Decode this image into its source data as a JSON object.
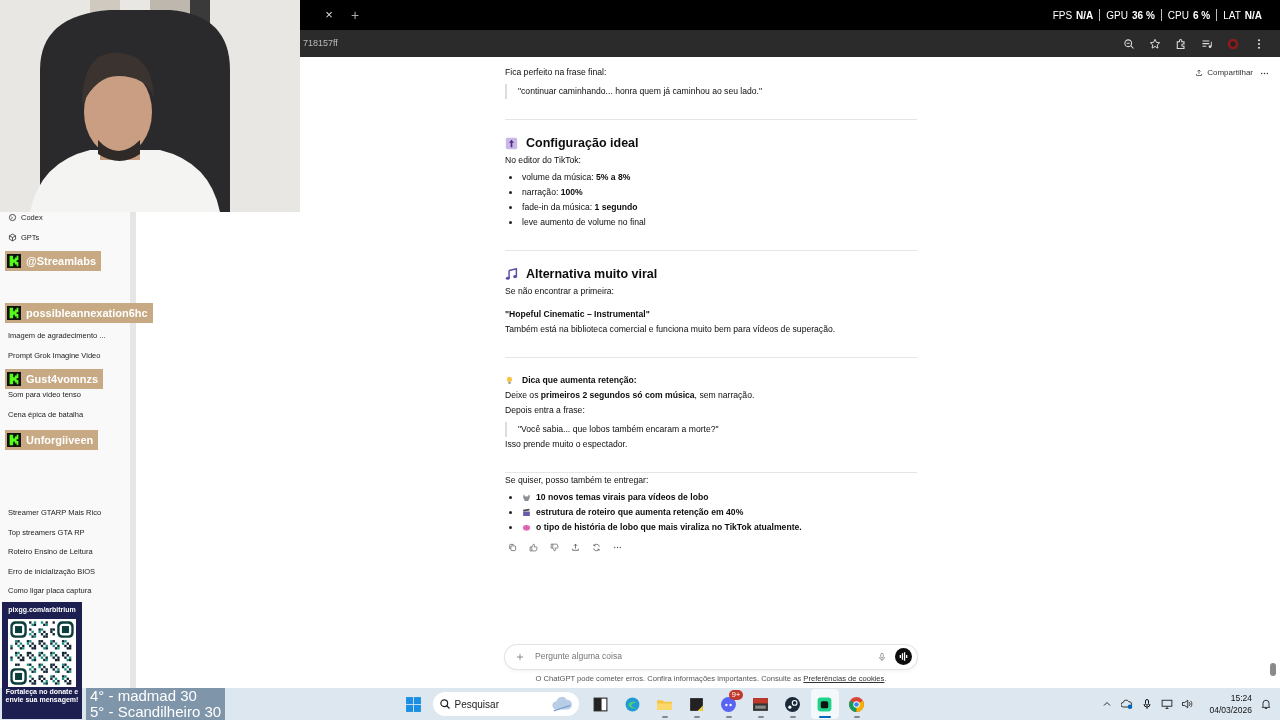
{
  "webcam": {
    "kind": "picture"
  },
  "browser": {
    "tab_close": "×",
    "new_tab": "+",
    "url": "718157ff"
  },
  "perf_overlay": [
    {
      "label": "FPS",
      "value": "N/A"
    },
    {
      "label": "GPU",
      "value": "36 %"
    },
    {
      "label": "CPU",
      "value": "6 %"
    },
    {
      "label": "LAT",
      "value": "N/A"
    }
  ],
  "sidebar": {
    "sections": [
      {
        "items": [
          {
            "label": "Codex"
          },
          {
            "label": "GPTs"
          }
        ]
      },
      {
        "items": [
          {
            "label": "Imagem de agradecimento ..."
          },
          {
            "label": "Prompt Grok Imagine Video"
          }
        ]
      },
      {
        "items": [
          {
            "label": "Som para video tenso"
          },
          {
            "label": "Cena épica de batalha"
          }
        ]
      },
      {
        "items": [
          {
            "label": "Streamer GTARP Mais Rico"
          },
          {
            "label": "Top streamers GTA RP"
          },
          {
            "label": "Roteiro Ensino de Leitura"
          },
          {
            "label": "Erro de inicialização BIOS"
          },
          {
            "label": "Como ligar placa captura"
          }
        ]
      }
    ]
  },
  "chat_overlay": [
    {
      "user": "@Streamlabs"
    },
    {
      "user": "possibleannexation6hc"
    },
    {
      "user": "Gust4vomnzs"
    },
    {
      "user": "Unforgiiveen"
    }
  ],
  "header": {
    "share": "Compartilhar"
  },
  "message": {
    "blocks": [
      {
        "kind": "paragraph",
        "text": "Fica perfeito na frase final:"
      },
      {
        "kind": "quote",
        "text": "\"continuar caminhando... honra quem já caminhou ao seu lado.\""
      },
      {
        "kind": "divider"
      },
      {
        "kind": "heading",
        "text": "Configuração ideal"
      },
      {
        "kind": "paragraph",
        "text": "No editor do TikTok:"
      },
      {
        "kind": "list",
        "items": [
          {
            "text": "volume da música: **5% a 8%**"
          },
          {
            "text": "narração: **100%**"
          },
          {
            "text": "fade-in da música: **1 segundo**"
          },
          {
            "text": "leve aumento de volume no final"
          }
        ]
      },
      {
        "kind": "divider"
      },
      {
        "kind": "heading",
        "text": "Alternativa muito viral"
      },
      {
        "kind": "paragraph",
        "text": "Se não encontrar a primeira:"
      },
      {
        "kind": "strong",
        "text": "\"Hopeful Cinematic – Instrumental\""
      },
      {
        "kind": "paragraph",
        "text": "Também está na biblioteca comercial e funciona muito bem para vídeos de superação."
      },
      {
        "kind": "divider"
      },
      {
        "kind": "tip",
        "text": "Dica que aumenta retenção:"
      },
      {
        "kind": "paragraph",
        "text": "Deixe os **primeiros 2 segundos só com música**, sem narração."
      },
      {
        "kind": "paragraph",
        "text": "Depois entra a frase:"
      },
      {
        "kind": "quote",
        "text": "\"Você sabia... que lobos também encaram a morte?\""
      },
      {
        "kind": "paragraph",
        "text": "Isso prende muito o espectador."
      },
      {
        "kind": "divider"
      },
      {
        "kind": "paragraph",
        "text": "Se quiser, posso também te entregar:"
      },
      {
        "kind": "options",
        "items": [
          {
            "text": "10 novos temas virais para vídeos de lobo"
          },
          {
            "text": "estrutura de roteiro que aumenta retenção em 40%"
          },
          {
            "text": "o tipo de história de lobo que mais viraliza no TikTok atualmente."
          }
        ]
      }
    ]
  },
  "composer": {
    "placeholder": "Pergunte alguma coisa"
  },
  "disclaimer": {
    "text": "O ChatGPT pode cometer erros. Confira informações importantes. Consulte as",
    "link": "Preferências de cookies",
    "end": "."
  },
  "donation": {
    "url": "pixgg.com/arbitrium",
    "message": "Fortaleça no donate e envie sua mensagem!"
  },
  "leaderboard": [
    "4° - madmad 30",
    "5° - Scandilheiro 30"
  ],
  "taskbar": {
    "search": "Pesquisar",
    "apps": [
      {
        "kind": "taskview",
        "running": false,
        "selected": false
      },
      {
        "kind": "edge",
        "running": false,
        "selected": false
      },
      {
        "kind": "explorer",
        "running": true,
        "selected": false
      },
      {
        "kind": "notes",
        "running": true,
        "selected": false
      },
      {
        "kind": "discord",
        "running": true,
        "selected": false,
        "badge": "9+"
      },
      {
        "kind": "mixer",
        "running": true,
        "selected": false
      },
      {
        "kind": "steam",
        "running": true,
        "selected": false
      },
      {
        "kind": "app",
        "running": true,
        "selected": true
      },
      {
        "kind": "chrome",
        "running": true,
        "selected": false
      }
    ],
    "time": "15:24",
    "date": "04/03/2026"
  }
}
